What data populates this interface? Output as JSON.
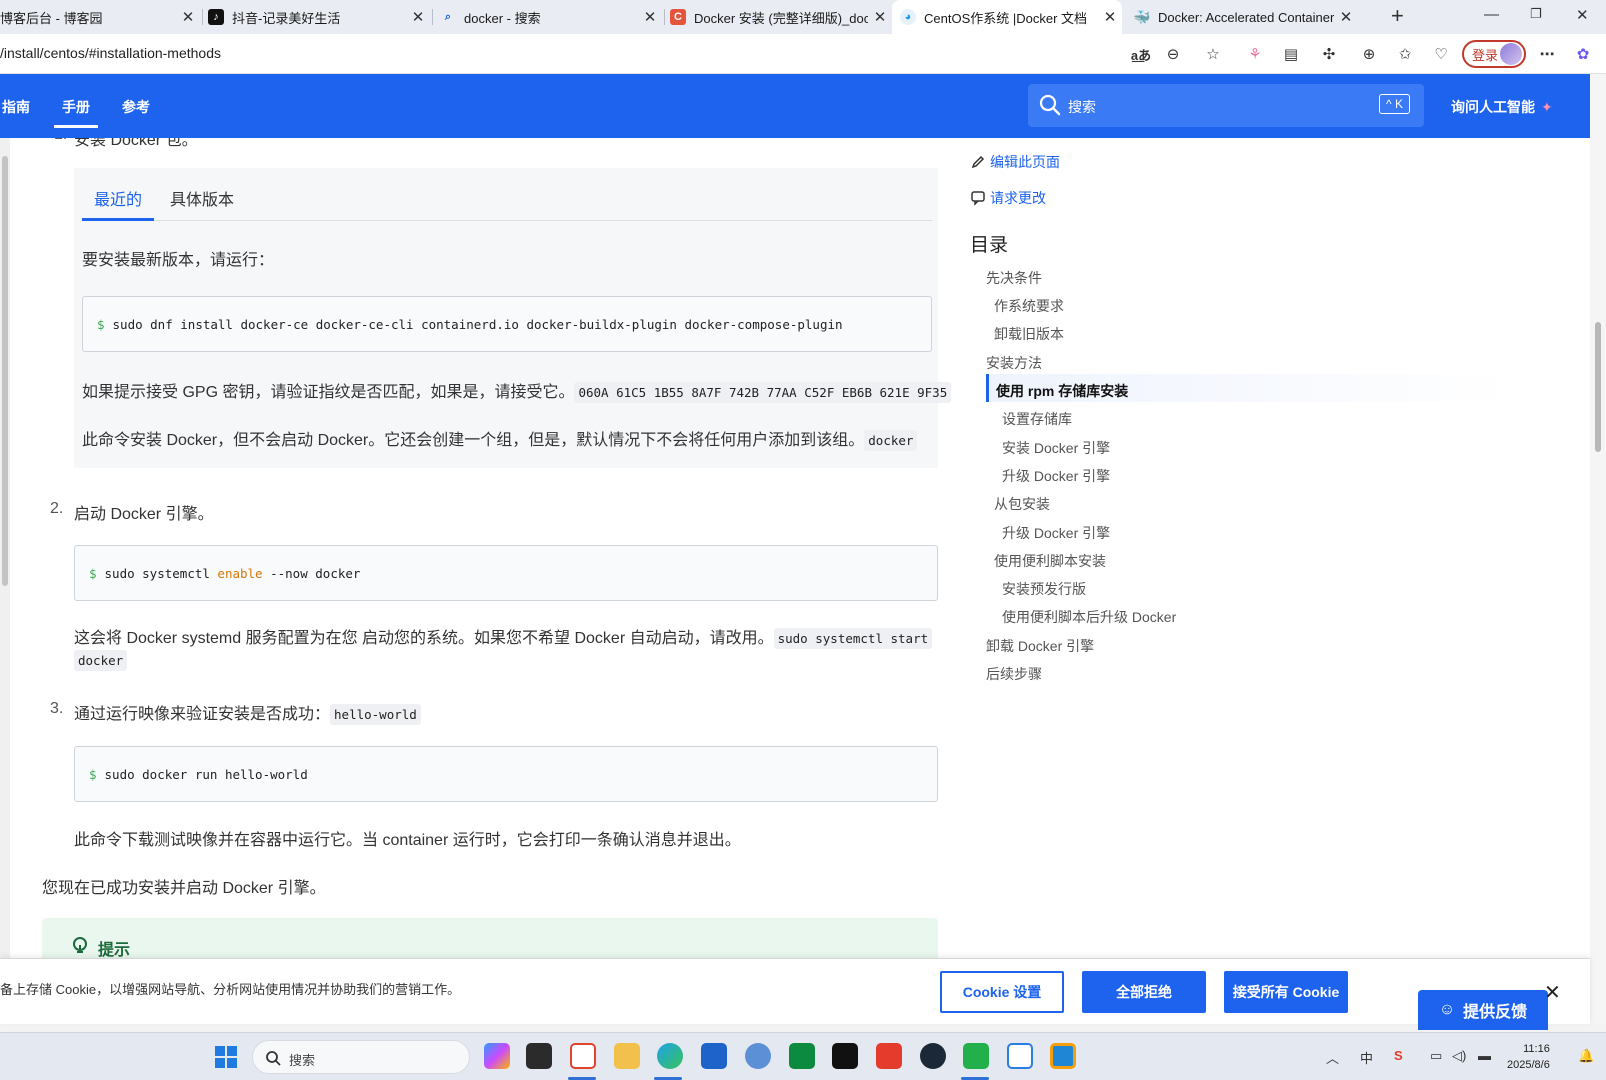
{
  "browser": {
    "tabs": [
      {
        "title": "博客后台 - 博客园"
      },
      {
        "title": "抖音-记录美好生活"
      },
      {
        "title": "docker - 搜索"
      },
      {
        "title": "Docker 安装 (完整详细版)_docker"
      },
      {
        "title": "CentOS作系统 |Docker 文档"
      },
      {
        "title": "Docker: Accelerated Container Ap"
      }
    ],
    "url": "/install/centos/#installation-methods",
    "login_label": "登录"
  },
  "header": {
    "nav": [
      "指南",
      "手册",
      "参考"
    ],
    "search_placeholder": "搜索",
    "search_shortcut": "^ K",
    "ai_label": "询问人工智能"
  },
  "content": {
    "step1_text": "安装 Docker 包。",
    "tabs": [
      "最近的",
      "具体版本"
    ],
    "install_intro": "要安装最新版本，请运行：",
    "install_cmd": "sudo dnf install docker-ce docker-ce-cli containerd.io docker-buildx-plugin docker-compose-plugin",
    "gpg_text": "如果提示接受 GPG 密钥，请验证指纹是否匹配，如果是，请接受它。",
    "gpg_fingerprint": "060A 61C5 1B55 8A7F 742B 77AA C52F EB6B 621E 9F35",
    "group_text": "此命令安装 Docker，但不会启动 Docker。它还会创建一个组，但是，默认情况下不会将任何用户添加到该组。",
    "group_code": "docker",
    "step2_num": "2.",
    "step2_text": "启动 Docker 引擎。",
    "enable_cmd_pre": "sudo systemctl",
    "enable_cmd_kw": "enable",
    "enable_cmd_post": "--now docker",
    "systemd_text": "这会将 Docker systemd 服务配置为在您 启动您的系统。如果您不希望 Docker 自动启动，请改用。",
    "systemd_code_1": "sudo systemctl start",
    "systemd_code_2": "docker",
    "step3_num": "3.",
    "step3_text": "通过运行映像来验证安装是否成功：",
    "step3_code": "hello-world",
    "run_cmd": "sudo docker run hello-world",
    "run_text": "此命令下载测试映像并在容器中运行它。当 container 运行时，它会打印一条确认消息并退出。",
    "success_text": "您现在已成功安装并启动 Docker 引擎。",
    "tip_label": "提示",
    "prompt_symbol": "$"
  },
  "sidebar": {
    "edit_page": "编辑此页面",
    "request_change": "请求更改",
    "toc_title": "目录",
    "toc": [
      {
        "label": "先决条件",
        "level": 0
      },
      {
        "label": "作系统要求",
        "level": 1
      },
      {
        "label": "卸载旧版本",
        "level": 1
      },
      {
        "label": "安装方法",
        "level": 0
      },
      {
        "label": "使用 rpm 存储库安装",
        "level": 1,
        "current": true
      },
      {
        "label": "设置存储库",
        "level": 2
      },
      {
        "label": "安装 Docker 引擎",
        "level": 2
      },
      {
        "label": "升级 Docker 引擎",
        "level": 2
      },
      {
        "label": "从包安装",
        "level": 1
      },
      {
        "label": "升级 Docker 引擎",
        "level": 2
      },
      {
        "label": "使用便利脚本安装",
        "level": 1
      },
      {
        "label": "安装预发行版",
        "level": 2
      },
      {
        "label": "使用便利脚本后升级 Docker",
        "level": 2
      },
      {
        "label": "卸载 Docker 引擎",
        "level": 0
      },
      {
        "label": "后续步骤",
        "level": 0
      }
    ]
  },
  "cookie_banner": {
    "message": "备上存储 Cookie，以增强网站导航、分析网站使用情况并协助我们的营销工作。",
    "settings_label": "Cookie 设置",
    "reject_label": "全部拒绝",
    "accept_label": "接受所有 Cookie",
    "feedback_label": "提供反馈"
  },
  "taskbar": {
    "search_placeholder": "搜索",
    "ime": "中",
    "time": "11:16",
    "date": "2025/8/6"
  },
  "colors": {
    "brand_blue": "#1d63ed",
    "tip_green": "#e9f7ee",
    "prompt_green": "#3aa757",
    "keyword_orange": "#d97706"
  }
}
